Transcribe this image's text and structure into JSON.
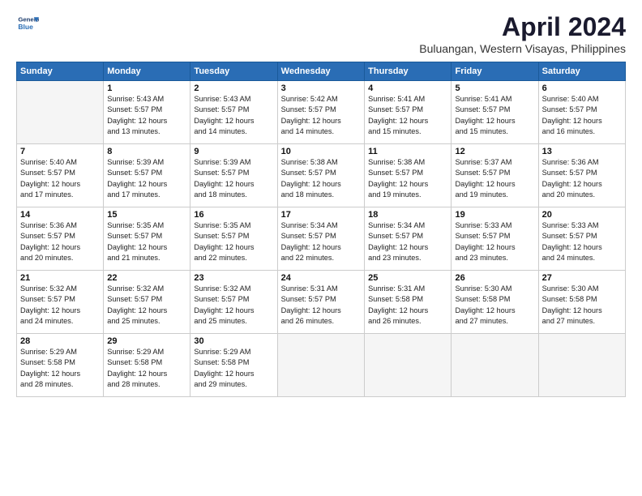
{
  "header": {
    "logo_line1": "General",
    "logo_line2": "Blue",
    "title": "April 2024",
    "subtitle": "Buluangan, Western Visayas, Philippines"
  },
  "weekdays": [
    "Sunday",
    "Monday",
    "Tuesday",
    "Wednesday",
    "Thursday",
    "Friday",
    "Saturday"
  ],
  "weeks": [
    [
      {
        "day": "",
        "empty": true
      },
      {
        "day": "1",
        "sunrise": "5:43 AM",
        "sunset": "5:57 PM",
        "daylight": "12 hours and 13 minutes."
      },
      {
        "day": "2",
        "sunrise": "5:43 AM",
        "sunset": "5:57 PM",
        "daylight": "12 hours and 14 minutes."
      },
      {
        "day": "3",
        "sunrise": "5:42 AM",
        "sunset": "5:57 PM",
        "daylight": "12 hours and 14 minutes."
      },
      {
        "day": "4",
        "sunrise": "5:41 AM",
        "sunset": "5:57 PM",
        "daylight": "12 hours and 15 minutes."
      },
      {
        "day": "5",
        "sunrise": "5:41 AM",
        "sunset": "5:57 PM",
        "daylight": "12 hours and 15 minutes."
      },
      {
        "day": "6",
        "sunrise": "5:40 AM",
        "sunset": "5:57 PM",
        "daylight": "12 hours and 16 minutes."
      }
    ],
    [
      {
        "day": "7",
        "sunrise": "5:40 AM",
        "sunset": "5:57 PM",
        "daylight": "12 hours and 17 minutes."
      },
      {
        "day": "8",
        "sunrise": "5:39 AM",
        "sunset": "5:57 PM",
        "daylight": "12 hours and 17 minutes."
      },
      {
        "day": "9",
        "sunrise": "5:39 AM",
        "sunset": "5:57 PM",
        "daylight": "12 hours and 18 minutes."
      },
      {
        "day": "10",
        "sunrise": "5:38 AM",
        "sunset": "5:57 PM",
        "daylight": "12 hours and 18 minutes."
      },
      {
        "day": "11",
        "sunrise": "5:38 AM",
        "sunset": "5:57 PM",
        "daylight": "12 hours and 19 minutes."
      },
      {
        "day": "12",
        "sunrise": "5:37 AM",
        "sunset": "5:57 PM",
        "daylight": "12 hours and 19 minutes."
      },
      {
        "day": "13",
        "sunrise": "5:36 AM",
        "sunset": "5:57 PM",
        "daylight": "12 hours and 20 minutes."
      }
    ],
    [
      {
        "day": "14",
        "sunrise": "5:36 AM",
        "sunset": "5:57 PM",
        "daylight": "12 hours and 20 minutes."
      },
      {
        "day": "15",
        "sunrise": "5:35 AM",
        "sunset": "5:57 PM",
        "daylight": "12 hours and 21 minutes."
      },
      {
        "day": "16",
        "sunrise": "5:35 AM",
        "sunset": "5:57 PM",
        "daylight": "12 hours and 22 minutes."
      },
      {
        "day": "17",
        "sunrise": "5:34 AM",
        "sunset": "5:57 PM",
        "daylight": "12 hours and 22 minutes."
      },
      {
        "day": "18",
        "sunrise": "5:34 AM",
        "sunset": "5:57 PM",
        "daylight": "12 hours and 23 minutes."
      },
      {
        "day": "19",
        "sunrise": "5:33 AM",
        "sunset": "5:57 PM",
        "daylight": "12 hours and 23 minutes."
      },
      {
        "day": "20",
        "sunrise": "5:33 AM",
        "sunset": "5:57 PM",
        "daylight": "12 hours and 24 minutes."
      }
    ],
    [
      {
        "day": "21",
        "sunrise": "5:32 AM",
        "sunset": "5:57 PM",
        "daylight": "12 hours and 24 minutes."
      },
      {
        "day": "22",
        "sunrise": "5:32 AM",
        "sunset": "5:57 PM",
        "daylight": "12 hours and 25 minutes."
      },
      {
        "day": "23",
        "sunrise": "5:32 AM",
        "sunset": "5:57 PM",
        "daylight": "12 hours and 25 minutes."
      },
      {
        "day": "24",
        "sunrise": "5:31 AM",
        "sunset": "5:57 PM",
        "daylight": "12 hours and 26 minutes."
      },
      {
        "day": "25",
        "sunrise": "5:31 AM",
        "sunset": "5:58 PM",
        "daylight": "12 hours and 26 minutes."
      },
      {
        "day": "26",
        "sunrise": "5:30 AM",
        "sunset": "5:58 PM",
        "daylight": "12 hours and 27 minutes."
      },
      {
        "day": "27",
        "sunrise": "5:30 AM",
        "sunset": "5:58 PM",
        "daylight": "12 hours and 27 minutes."
      }
    ],
    [
      {
        "day": "28",
        "sunrise": "5:29 AM",
        "sunset": "5:58 PM",
        "daylight": "12 hours and 28 minutes."
      },
      {
        "day": "29",
        "sunrise": "5:29 AM",
        "sunset": "5:58 PM",
        "daylight": "12 hours and 28 minutes."
      },
      {
        "day": "30",
        "sunrise": "5:29 AM",
        "sunset": "5:58 PM",
        "daylight": "12 hours and 29 minutes."
      },
      {
        "day": "",
        "empty": true
      },
      {
        "day": "",
        "empty": true
      },
      {
        "day": "",
        "empty": true
      },
      {
        "day": "",
        "empty": true
      }
    ]
  ],
  "labels": {
    "sunrise_prefix": "Sunrise: ",
    "sunset_prefix": "Sunset: ",
    "daylight_prefix": "Daylight: "
  }
}
